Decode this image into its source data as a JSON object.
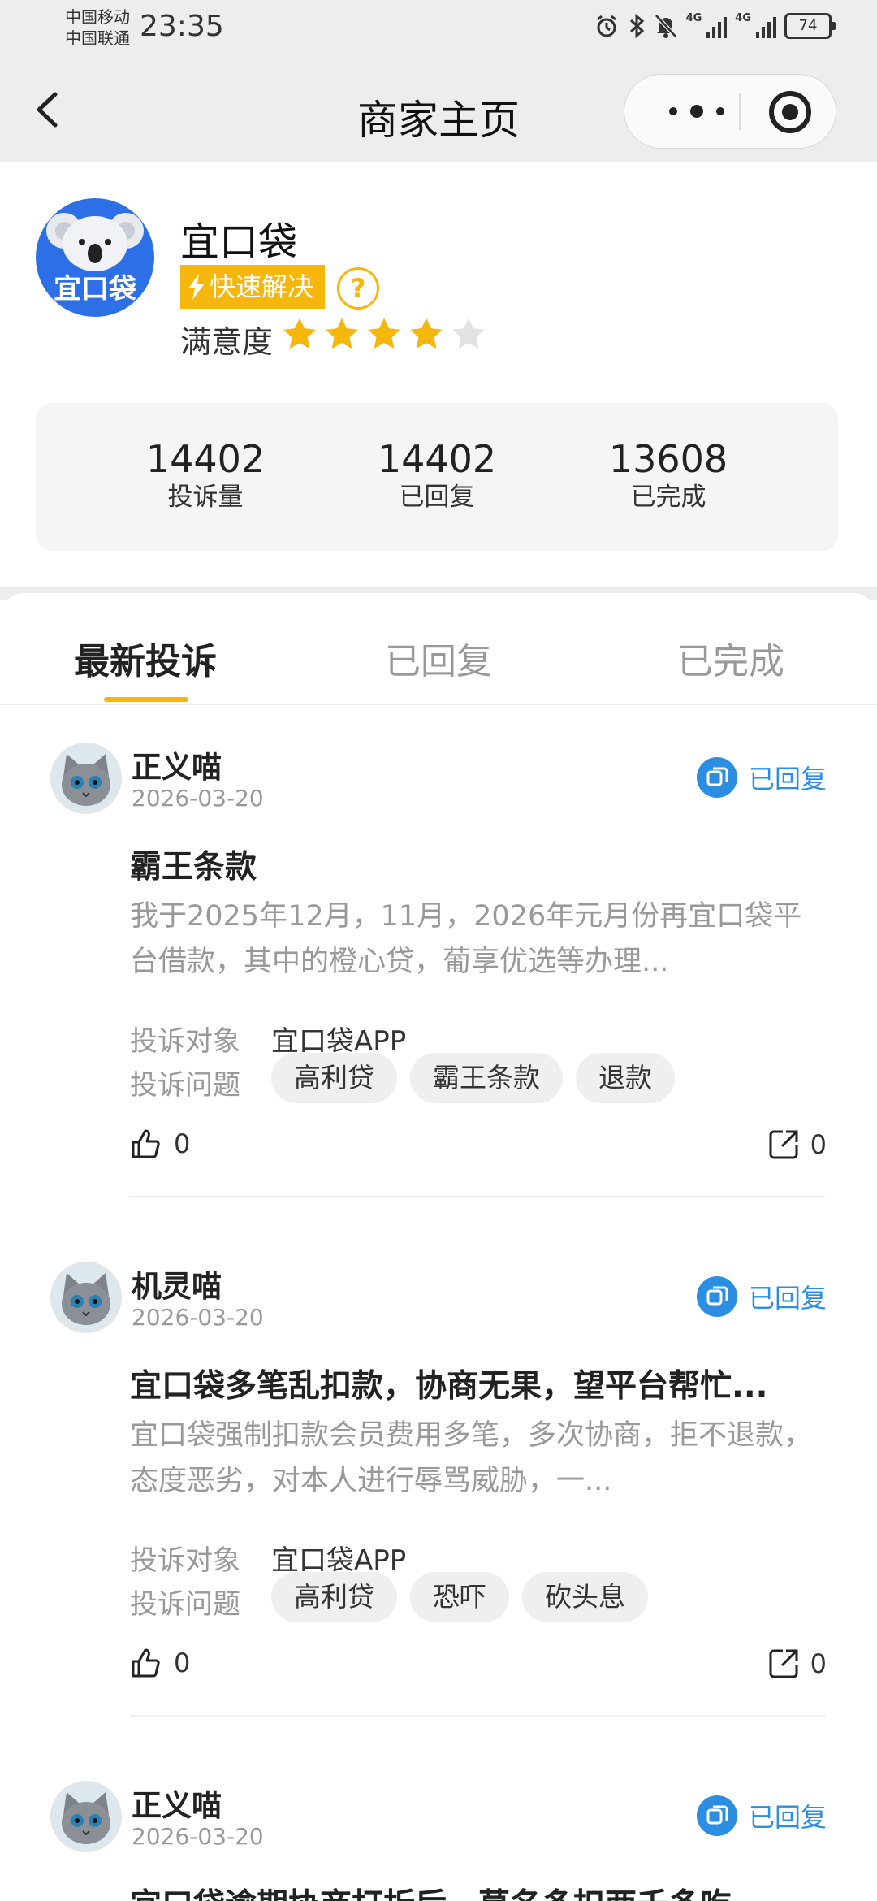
{
  "status_bar": {
    "carrier1": "中国移动",
    "carrier2": "中国联通",
    "time": "23:35",
    "battery": "74",
    "network1": "4G",
    "network2": "4G"
  },
  "nav": {
    "title": "商家主页"
  },
  "merchant": {
    "name": "宜口袋",
    "logo_text": "宜口袋",
    "badge": "快速解决",
    "help": "?",
    "satisfaction_label": "满意度",
    "rating": 4,
    "rating_max": 5,
    "stats": [
      {
        "value": "14402",
        "label": "投诉量"
      },
      {
        "value": "14402",
        "label": "已回复"
      },
      {
        "value": "13608",
        "label": "已完成"
      }
    ]
  },
  "tabs": [
    {
      "label": "最新投诉",
      "active": true
    },
    {
      "label": "已回复",
      "active": false
    },
    {
      "label": "已完成",
      "active": false
    }
  ],
  "complaints": [
    {
      "user": "正义喵",
      "date": "2026-03-20",
      "status": "已回复",
      "title": "霸王条款",
      "desc": "我于2025年12月，11月，2026年元月份再宜口袋平台借款，其中的橙心贷，葡享优选等办理...",
      "target_label": "投诉对象",
      "target": "宜口袋APP",
      "issue_label": "投诉问题",
      "tags": [
        "高利贷",
        "霸王条款",
        "退款"
      ],
      "likes": "0",
      "shares": "0"
    },
    {
      "user": "机灵喵",
      "date": "2026-03-20",
      "status": "已回复",
      "title": "宜口袋多笔乱扣款，协商无果，望平台帮忙...",
      "desc": "宜口袋强制扣款会员费用多笔，多次协商，拒不退款，态度恶劣，对本人进行辱骂威胁，一...",
      "target_label": "投诉对象",
      "target": "宜口袋APP",
      "issue_label": "投诉问题",
      "tags": [
        "高利贷",
        "恐吓",
        "砍头息"
      ],
      "likes": "0",
      "shares": "0"
    },
    {
      "user": "正义喵",
      "date": "2026-03-20",
      "status": "已回复",
      "title": "宜口袋逾期协商打折后，莫名多扣两千多吃"
    }
  ],
  "colors": {
    "accent": "#f5b70c",
    "status_blue": "#2b8ee0",
    "logo_blue": "#2d6fe6",
    "star_off": "#e2e2e2"
  }
}
